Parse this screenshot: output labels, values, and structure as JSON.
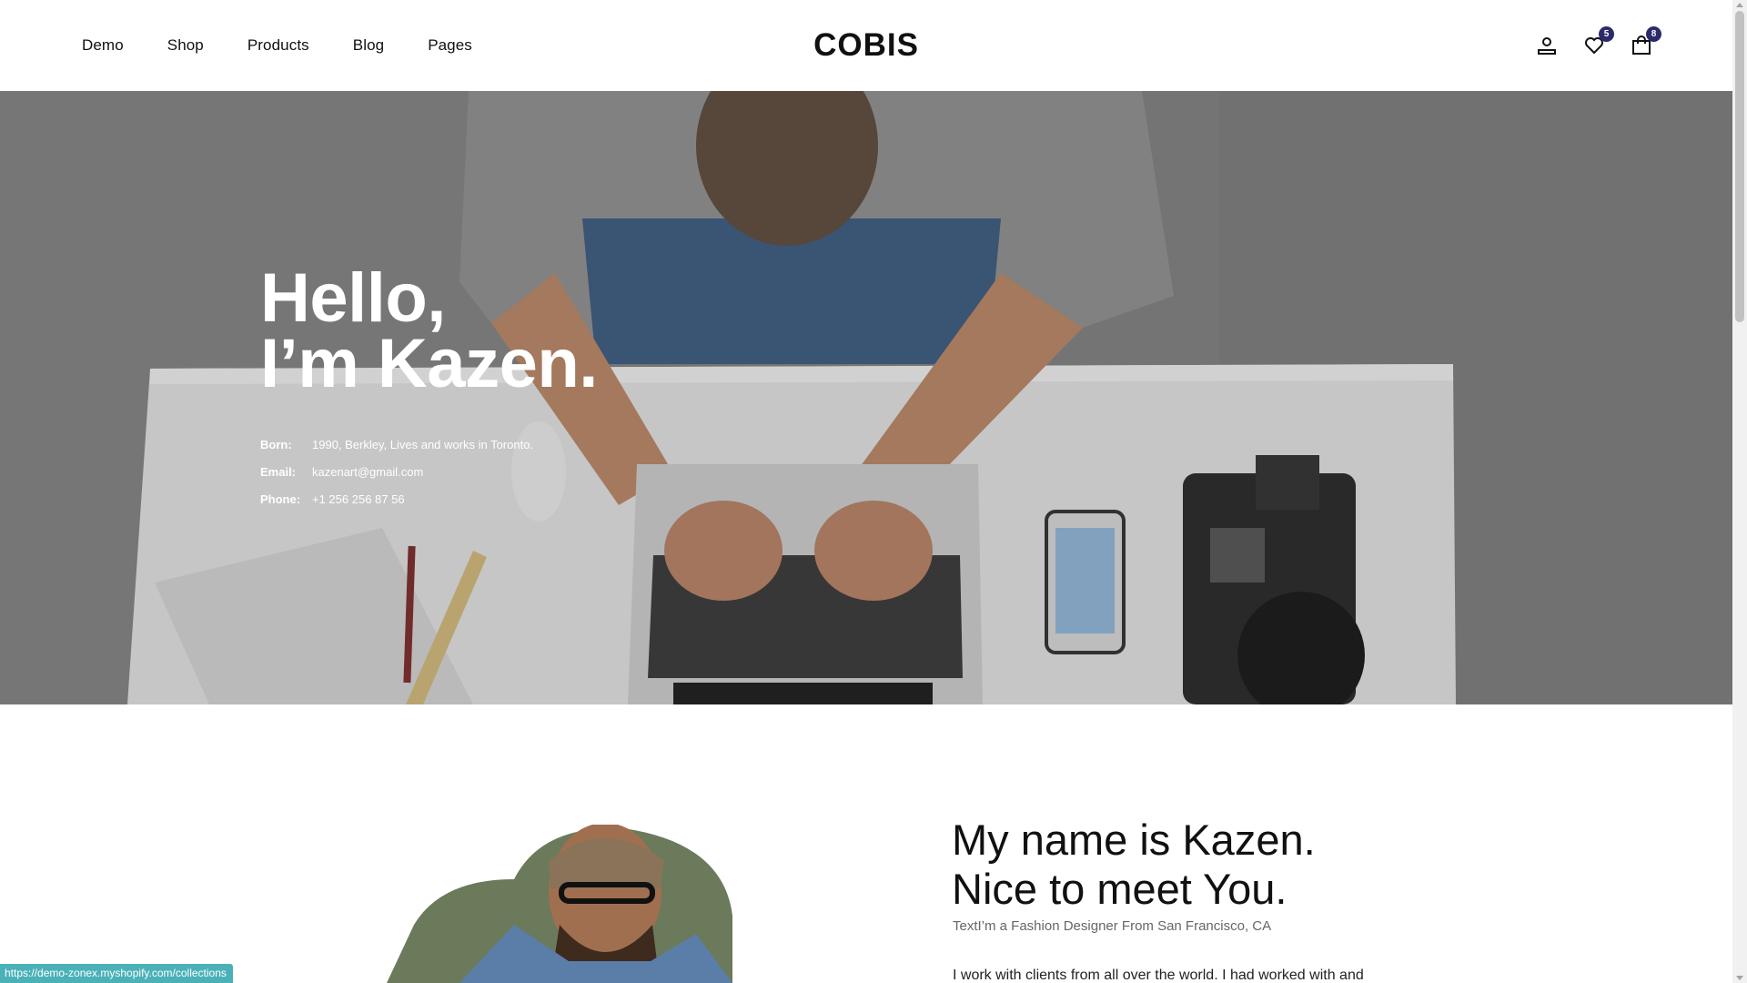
{
  "nav": {
    "items": [
      "Demo",
      "Shop",
      "Products",
      "Blog",
      "Pages"
    ]
  },
  "logo": "COBIS",
  "header_icons": {
    "account": "user-icon",
    "wishlist": "heart-icon",
    "wishlist_count": "5",
    "cart": "shopping-bag-icon",
    "cart_count": "8"
  },
  "hero": {
    "title_line1": "Hello,",
    "title_line2": "I’m Kazen.",
    "info": [
      {
        "label": "Born:",
        "value": "1990, Berkley, Lives and works in Toronto."
      },
      {
        "label": "Email:",
        "value": "kazenart@gmail.com"
      },
      {
        "label": "Phone:",
        "value": "+1 256 256 87 56"
      }
    ]
  },
  "about": {
    "title_line1": "My name is Kazen.",
    "title_line2": "Nice to meet You.",
    "subtitle": "TextI’m a Fashion Designer From San Francisco, CA",
    "body_preview": "I work with clients from all over the world. I had worked with and"
  },
  "status_bar": {
    "url": "https://demo-zonex.myshopify.com/collections"
  },
  "colors": {
    "badge": "#2b2b6b",
    "status_bar": "#4bb1b8"
  }
}
